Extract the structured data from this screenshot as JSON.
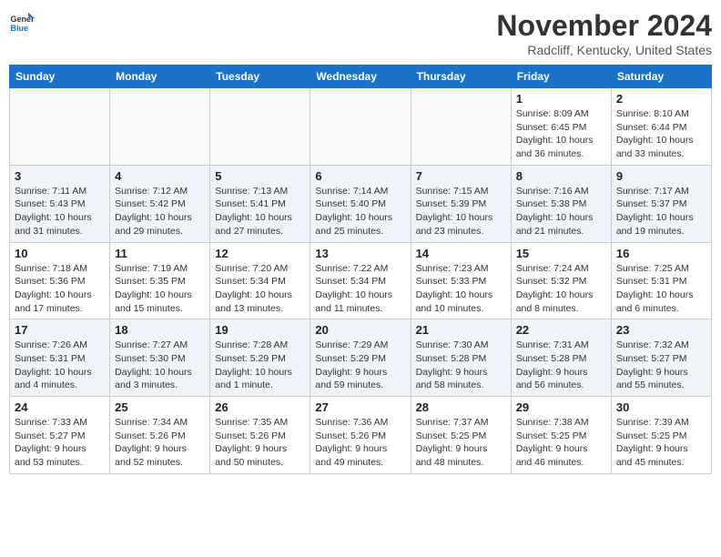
{
  "header": {
    "logo_line1": "General",
    "logo_line2": "Blue",
    "month": "November 2024",
    "location": "Radcliff, Kentucky, United States"
  },
  "days_of_week": [
    "Sunday",
    "Monday",
    "Tuesday",
    "Wednesday",
    "Thursday",
    "Friday",
    "Saturday"
  ],
  "weeks": [
    [
      {
        "day": "",
        "info": ""
      },
      {
        "day": "",
        "info": ""
      },
      {
        "day": "",
        "info": ""
      },
      {
        "day": "",
        "info": ""
      },
      {
        "day": "",
        "info": ""
      },
      {
        "day": "1",
        "info": "Sunrise: 8:09 AM\nSunset: 6:45 PM\nDaylight: 10 hours\nand 36 minutes."
      },
      {
        "day": "2",
        "info": "Sunrise: 8:10 AM\nSunset: 6:44 PM\nDaylight: 10 hours\nand 33 minutes."
      }
    ],
    [
      {
        "day": "3",
        "info": "Sunrise: 7:11 AM\nSunset: 5:43 PM\nDaylight: 10 hours\nand 31 minutes."
      },
      {
        "day": "4",
        "info": "Sunrise: 7:12 AM\nSunset: 5:42 PM\nDaylight: 10 hours\nand 29 minutes."
      },
      {
        "day": "5",
        "info": "Sunrise: 7:13 AM\nSunset: 5:41 PM\nDaylight: 10 hours\nand 27 minutes."
      },
      {
        "day": "6",
        "info": "Sunrise: 7:14 AM\nSunset: 5:40 PM\nDaylight: 10 hours\nand 25 minutes."
      },
      {
        "day": "7",
        "info": "Sunrise: 7:15 AM\nSunset: 5:39 PM\nDaylight: 10 hours\nand 23 minutes."
      },
      {
        "day": "8",
        "info": "Sunrise: 7:16 AM\nSunset: 5:38 PM\nDaylight: 10 hours\nand 21 minutes."
      },
      {
        "day": "9",
        "info": "Sunrise: 7:17 AM\nSunset: 5:37 PM\nDaylight: 10 hours\nand 19 minutes."
      }
    ],
    [
      {
        "day": "10",
        "info": "Sunrise: 7:18 AM\nSunset: 5:36 PM\nDaylight: 10 hours\nand 17 minutes."
      },
      {
        "day": "11",
        "info": "Sunrise: 7:19 AM\nSunset: 5:35 PM\nDaylight: 10 hours\nand 15 minutes."
      },
      {
        "day": "12",
        "info": "Sunrise: 7:20 AM\nSunset: 5:34 PM\nDaylight: 10 hours\nand 13 minutes."
      },
      {
        "day": "13",
        "info": "Sunrise: 7:22 AM\nSunset: 5:34 PM\nDaylight: 10 hours\nand 11 minutes."
      },
      {
        "day": "14",
        "info": "Sunrise: 7:23 AM\nSunset: 5:33 PM\nDaylight: 10 hours\nand 10 minutes."
      },
      {
        "day": "15",
        "info": "Sunrise: 7:24 AM\nSunset: 5:32 PM\nDaylight: 10 hours\nand 8 minutes."
      },
      {
        "day": "16",
        "info": "Sunrise: 7:25 AM\nSunset: 5:31 PM\nDaylight: 10 hours\nand 6 minutes."
      }
    ],
    [
      {
        "day": "17",
        "info": "Sunrise: 7:26 AM\nSunset: 5:31 PM\nDaylight: 10 hours\nand 4 minutes."
      },
      {
        "day": "18",
        "info": "Sunrise: 7:27 AM\nSunset: 5:30 PM\nDaylight: 10 hours\nand 3 minutes."
      },
      {
        "day": "19",
        "info": "Sunrise: 7:28 AM\nSunset: 5:29 PM\nDaylight: 10 hours\nand 1 minute."
      },
      {
        "day": "20",
        "info": "Sunrise: 7:29 AM\nSunset: 5:29 PM\nDaylight: 9 hours\nand 59 minutes."
      },
      {
        "day": "21",
        "info": "Sunrise: 7:30 AM\nSunset: 5:28 PM\nDaylight: 9 hours\nand 58 minutes."
      },
      {
        "day": "22",
        "info": "Sunrise: 7:31 AM\nSunset: 5:28 PM\nDaylight: 9 hours\nand 56 minutes."
      },
      {
        "day": "23",
        "info": "Sunrise: 7:32 AM\nSunset: 5:27 PM\nDaylight: 9 hours\nand 55 minutes."
      }
    ],
    [
      {
        "day": "24",
        "info": "Sunrise: 7:33 AM\nSunset: 5:27 PM\nDaylight: 9 hours\nand 53 minutes."
      },
      {
        "day": "25",
        "info": "Sunrise: 7:34 AM\nSunset: 5:26 PM\nDaylight: 9 hours\nand 52 minutes."
      },
      {
        "day": "26",
        "info": "Sunrise: 7:35 AM\nSunset: 5:26 PM\nDaylight: 9 hours\nand 50 minutes."
      },
      {
        "day": "27",
        "info": "Sunrise: 7:36 AM\nSunset: 5:26 PM\nDaylight: 9 hours\nand 49 minutes."
      },
      {
        "day": "28",
        "info": "Sunrise: 7:37 AM\nSunset: 5:25 PM\nDaylight: 9 hours\nand 48 minutes."
      },
      {
        "day": "29",
        "info": "Sunrise: 7:38 AM\nSunset: 5:25 PM\nDaylight: 9 hours\nand 46 minutes."
      },
      {
        "day": "30",
        "info": "Sunrise: 7:39 AM\nSunset: 5:25 PM\nDaylight: 9 hours\nand 45 minutes."
      }
    ]
  ]
}
